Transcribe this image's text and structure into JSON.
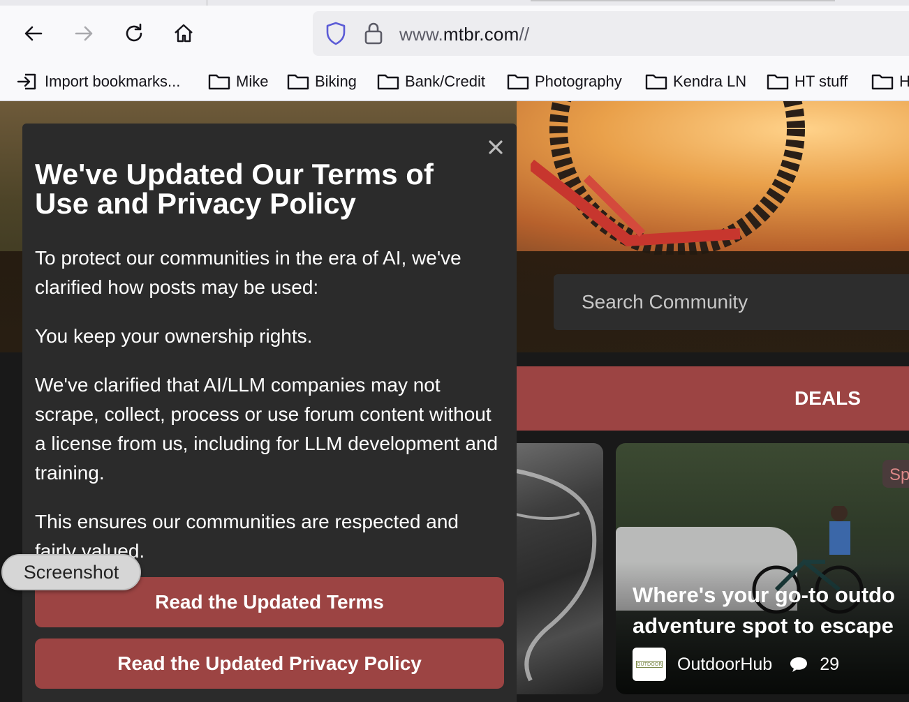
{
  "browser": {
    "url_domain": "www.mtbr.com",
    "url_path": "//",
    "bookmarks": [
      {
        "label": "Import bookmarks...",
        "icon": "import-icon"
      },
      {
        "label": "Mike",
        "icon": "folder-icon"
      },
      {
        "label": "Biking",
        "icon": "folder-icon"
      },
      {
        "label": "Bank/Credit",
        "icon": "folder-icon"
      },
      {
        "label": "Photography",
        "icon": "folder-icon"
      },
      {
        "label": "Kendra LN",
        "icon": "folder-icon"
      },
      {
        "label": "HT stuff",
        "icon": "folder-icon"
      },
      {
        "label": "H",
        "icon": "folder-icon"
      }
    ]
  },
  "site": {
    "search_placeholder": "Search Community",
    "deals_label": "DEALS",
    "card": {
      "badge": "Sp",
      "title_line1": "Where's your go-to outdo",
      "title_line2": "adventure spot to escape",
      "source": "OutdoorHub",
      "comments": "29"
    }
  },
  "modal": {
    "title": "We've Updated Our Terms of Use and Privacy Policy",
    "paragraphs": [
      "To protect our communities in the era of AI, we've clarified how posts may be used:",
      "You keep your ownership rights.",
      "We've clarified that AI/LLM companies may not scrape, collect, process or use forum content without a license from us, including for LLM development and training.",
      "This ensures our communities are respected and fairly valued."
    ],
    "terms_button": "Read the Updated Terms",
    "privacy_button": "Read the Updated Privacy Policy"
  },
  "overlay": {
    "screenshot_label": "Screenshot"
  },
  "colors": {
    "accent_red": "#9c4443",
    "modal_bg": "#2b2b2b",
    "browser_bg": "#f9f9fb"
  }
}
